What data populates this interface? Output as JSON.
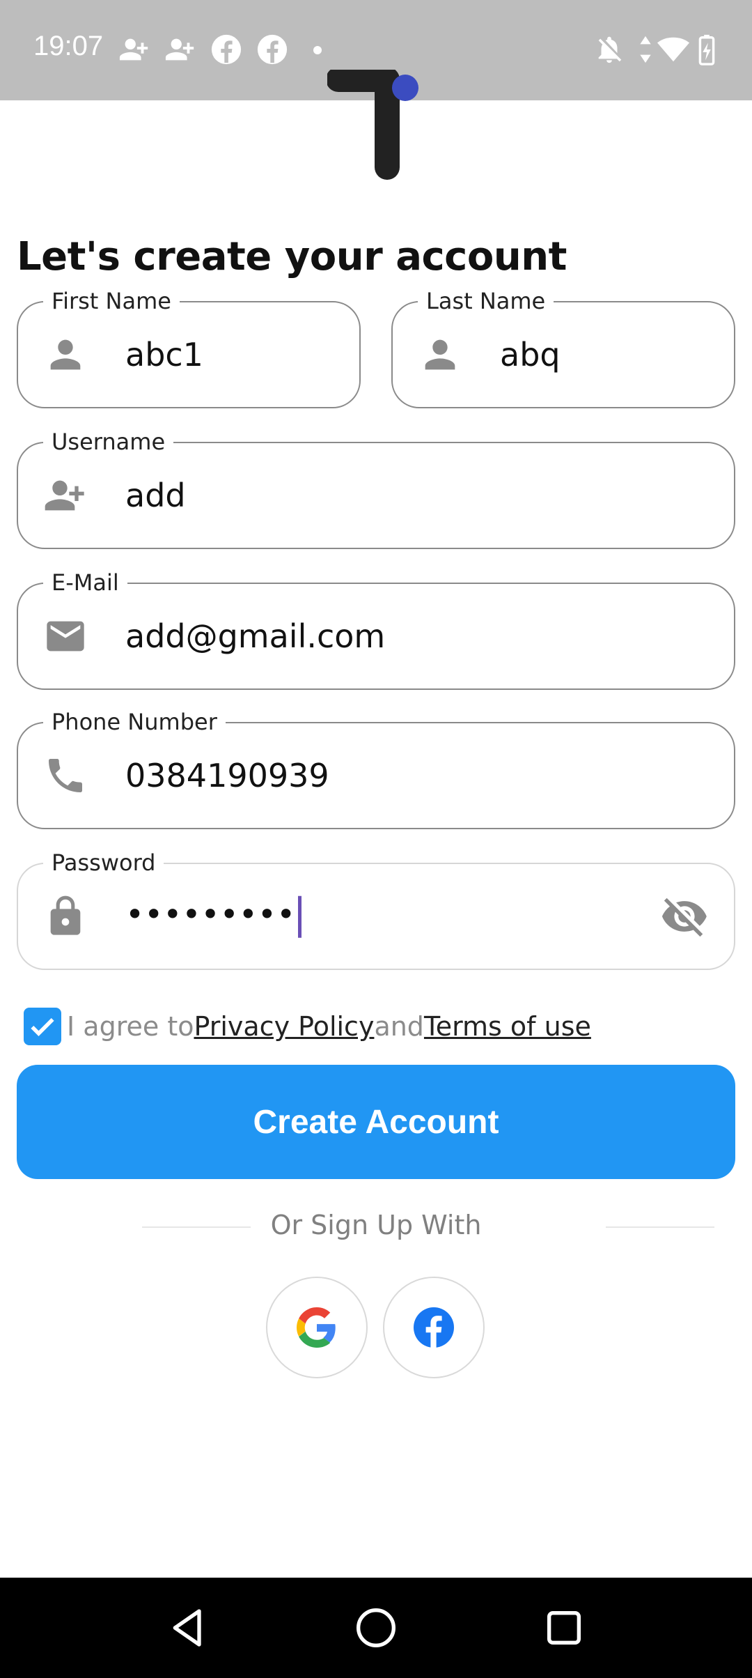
{
  "status_bar": {
    "time": "19:07",
    "icons": [
      "person-add-icon",
      "person-add-icon",
      "facebook-icon",
      "facebook-icon",
      "dot-icon",
      "notifications-off-icon",
      "data-arrows-icon",
      "wifi-icon",
      "battery-charging-icon"
    ]
  },
  "logo": {
    "name": "app-logo",
    "accent": "#3b4cc0"
  },
  "page": {
    "heading": "Let's create your account"
  },
  "form": {
    "first_name": {
      "label": "First Name",
      "value": "abc1",
      "icon": "person-icon"
    },
    "last_name": {
      "label": "Last Name",
      "value": "abq",
      "icon": "person-icon"
    },
    "username": {
      "label": "Username",
      "value": "add",
      "icon": "person-add-icon"
    },
    "email": {
      "label": "E-Mail",
      "value": "add@gmail.com",
      "icon": "mail-icon"
    },
    "phone": {
      "label": "Phone Number",
      "value": "0384190939",
      "icon": "phone-icon"
    },
    "password": {
      "label": "Password",
      "value": "•••••••••",
      "icon": "lock-icon",
      "toggle_icon": "eye-off-icon"
    }
  },
  "terms": {
    "checked": true,
    "prefix": "I agree to",
    "privacy": "Privacy Policy",
    "and": "and",
    "terms": "Terms of use"
  },
  "create_button": {
    "label": "Create Account",
    "color": "#2196f3"
  },
  "divider": {
    "text": "Or Sign Up With"
  },
  "social": [
    {
      "name": "google-icon"
    },
    {
      "name": "facebook-icon",
      "color": "#1877f2"
    }
  ],
  "nav": [
    "back-icon",
    "home-icon",
    "recents-icon"
  ]
}
